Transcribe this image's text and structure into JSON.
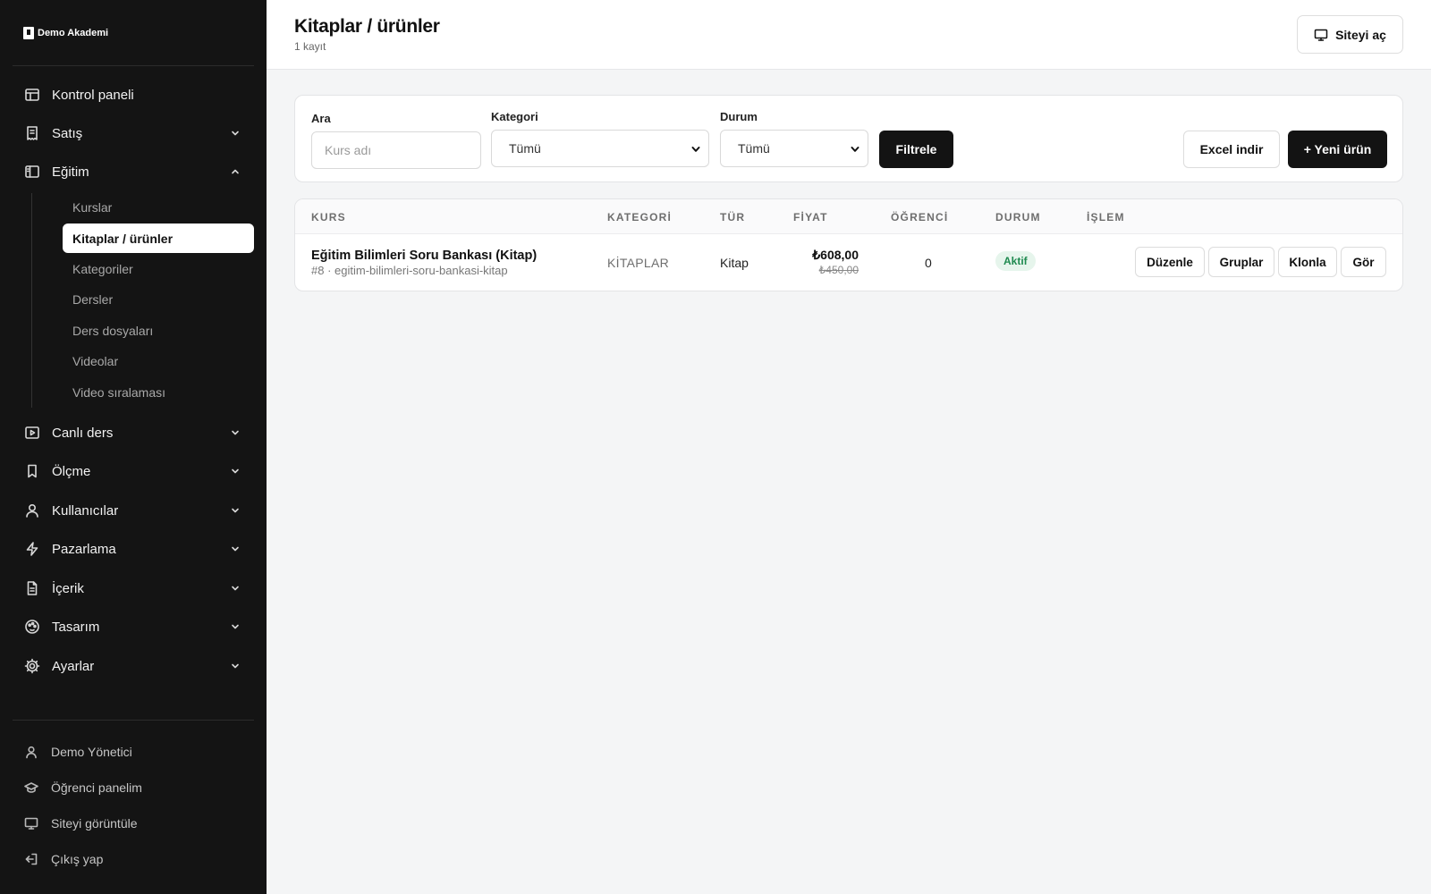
{
  "brand": {
    "name": "Demo Akademi",
    "icon": "logo-icon"
  },
  "sidebar": {
    "items": [
      {
        "label": "Kontrol paneli",
        "icon": "layout-icon"
      },
      {
        "label": "Satış",
        "icon": "receipt-icon"
      },
      {
        "label": "Eğitim",
        "icon": "sidebar-panel-icon",
        "expanded": true
      },
      {
        "label": "Canlı ders",
        "icon": "play-icon"
      },
      {
        "label": "Ölçme",
        "icon": "bookmark-icon"
      },
      {
        "label": "Kullanıcılar",
        "icon": "user-icon"
      },
      {
        "label": "Pazarlama",
        "icon": "zap-icon"
      },
      {
        "label": "İçerik",
        "icon": "file-icon"
      },
      {
        "label": "Tasarım",
        "icon": "palette-icon"
      },
      {
        "label": "Ayarlar",
        "icon": "gear-icon"
      }
    ],
    "subitems": [
      {
        "label": "Kurslar"
      },
      {
        "label": "Kitaplar / ürünler",
        "active": true
      },
      {
        "label": "Kategoriler"
      },
      {
        "label": "Dersler"
      },
      {
        "label": "Ders dosyaları"
      },
      {
        "label": "Videolar"
      },
      {
        "label": "Video sıralaması"
      }
    ],
    "footer": [
      {
        "label": "Demo Yönetici",
        "icon": "user-icon"
      },
      {
        "label": "Öğrenci panelim",
        "icon": "graduation-cap-icon"
      },
      {
        "label": "Siteyi görüntüle",
        "icon": "monitor-icon"
      },
      {
        "label": "Çıkış yap",
        "icon": "logout-icon"
      }
    ]
  },
  "header": {
    "title": "Kitaplar / ürünler",
    "subtitle": "1 kayıt",
    "open_site_label": "Siteyi aç",
    "open_site_icon": "monitor-icon"
  },
  "filters": {
    "search_label": "Ara",
    "search_placeholder": "Kurs adı",
    "category_label": "Kategori",
    "category_value": "Tümü",
    "status_label": "Durum",
    "status_value": "Tümü",
    "filter_button": "Filtrele",
    "excel_button": "Excel indir",
    "new_button": "+ Yeni ürün"
  },
  "table": {
    "columns": [
      "KURS",
      "KATEGORİ",
      "TÜR",
      "FİYAT",
      "ÖĞRENCİ",
      "DURUM",
      "İŞLEM"
    ],
    "rows": [
      {
        "name": "Eğitim Bilimleri Soru Bankası (Kitap)",
        "slug": "#8 · egitim-bilimleri-soru-bankasi-kitap",
        "category": "KİTAPLAR",
        "type": "Kitap",
        "price": "₺608,00",
        "old_price": "₺450,00",
        "students": "0",
        "status": "Aktif",
        "actions": [
          "Düzenle",
          "Gruplar",
          "Klonla",
          "Gör"
        ]
      }
    ]
  },
  "colors": {
    "sidebar_bg": "#141414",
    "accent_dark": "#131313",
    "status_active": "#1e8a4f"
  }
}
